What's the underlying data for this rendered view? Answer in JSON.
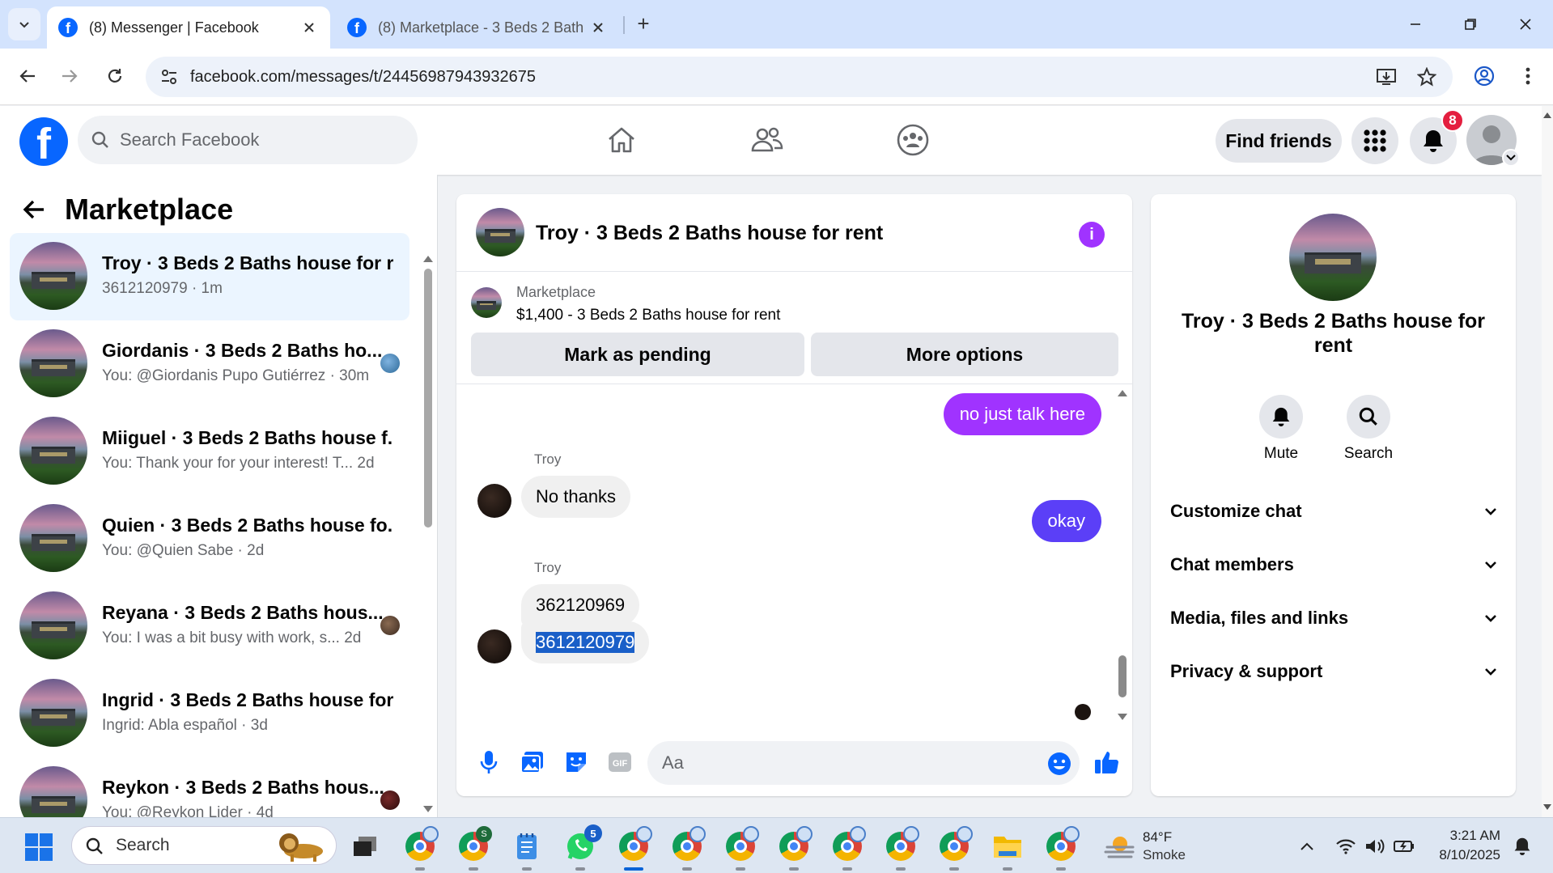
{
  "browser": {
    "tabs": [
      {
        "title": "(8) Messenger | Facebook"
      },
      {
        "title": "(8) Marketplace - 3 Beds 2 Bath"
      }
    ],
    "url": "facebook.com/messages/t/24456987943932675"
  },
  "fb_header": {
    "logo": "f",
    "search_placeholder": "Search Facebook",
    "find_friends": "Find friends",
    "notification_count": "8"
  },
  "left_panel": {
    "title": "Marketplace",
    "conversations": [
      {
        "name": "Troy · 3 Beds 2 Baths house for r...",
        "subtitle": "3612120979 · 1m"
      },
      {
        "name": "Giordanis · 3 Beds 2 Baths ho...",
        "subtitle": "You: @Giordanis Pupo Gutiérrez · 30m"
      },
      {
        "name": "Miiguel · 3 Beds 2 Baths house f...",
        "subtitle": "You: Thank your for your interest! T...  2d"
      },
      {
        "name": "Quien · 3 Beds 2 Baths house fo...",
        "subtitle": "You: @Quien Sabe · 2d"
      },
      {
        "name": "Reyana · 3 Beds 2 Baths hous...",
        "subtitle": "You: I was a bit busy with work, s...  2d"
      },
      {
        "name": "Ingrid · 3 Beds 2 Baths house for...",
        "subtitle": "Ingrid: Abla español · 3d"
      },
      {
        "name": "Reykon · 3 Beds 2 Baths hous...",
        "subtitle": "You: @Reykon Lider · 4d"
      }
    ]
  },
  "chat": {
    "title": "Troy · 3 Beds 2 Baths house for rent",
    "marketplace_label": "Marketplace",
    "listing": "$1,400 - 3 Beds 2 Baths house for rent",
    "mark_pending": "Mark as pending",
    "more_options": "More options",
    "messages": {
      "out1": "no just talk here",
      "sender1": "Troy",
      "in1": "No thanks",
      "out2": "okay",
      "sender2": "Troy",
      "in2": "362120969",
      "in3": "3612120979"
    },
    "composer_placeholder": "Aa"
  },
  "right_panel": {
    "name": "Troy · 3 Beds 2 Baths house for rent",
    "mute": "Mute",
    "search": "Search",
    "sections": [
      "Customize chat",
      "Chat members",
      "Media, files and links",
      "Privacy & support"
    ]
  },
  "taskbar": {
    "search": "Search",
    "whatsapp_badge": "5",
    "profile_letter": "S",
    "weather_temp": "84°F",
    "weather_cond": "Smoke",
    "time": "3:21 AM",
    "date": "8/10/2025"
  },
  "colors": {
    "fb_blue": "#0866ff",
    "messenger_purple": "#a033ff",
    "bubble_blue": "#5b3ff7",
    "notif_red": "#e41e3f"
  }
}
